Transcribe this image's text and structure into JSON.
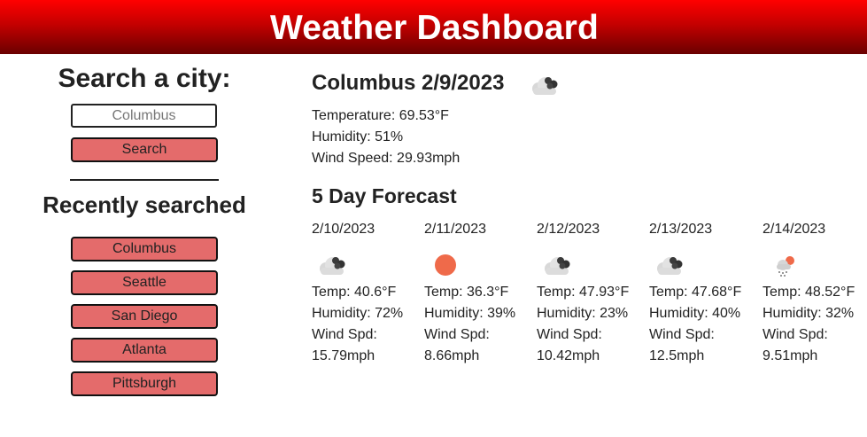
{
  "header": {
    "title": "Weather Dashboard"
  },
  "sidebar": {
    "search_title": "Search a city:",
    "search_placeholder": "Columbus",
    "search_button": "Search",
    "recent_title": "Recently searched",
    "recent": [
      "Columbus",
      "Seattle",
      "San Diego",
      "Atlanta",
      "Pittsburgh"
    ]
  },
  "current": {
    "title": "Columbus 2/9/2023",
    "icon": "cloudy-icon",
    "temperature": "Temperature: 69.53°F",
    "humidity": "Humidity: 51%",
    "wind": "Wind Speed: 29.93mph"
  },
  "forecast": {
    "title": "5 Day Forecast",
    "days": [
      {
        "date": "2/10/2023",
        "icon": "cloudy-icon",
        "temp": "Temp: 40.6°F",
        "humidity": "Humidity: 72%",
        "wind": "Wind Spd: 15.79mph"
      },
      {
        "date": "2/11/2023",
        "icon": "sun-icon",
        "temp": "Temp: 36.3°F",
        "humidity": "Humidity: 39%",
        "wind": "Wind Spd: 8.66mph"
      },
      {
        "date": "2/12/2023",
        "icon": "cloudy-icon",
        "temp": "Temp: 47.93°F",
        "humidity": "Humidity: 23%",
        "wind": "Wind Spd: 10.42mph"
      },
      {
        "date": "2/13/2023",
        "icon": "cloudy-icon",
        "temp": "Temp: 47.68°F",
        "humidity": "Humidity: 40%",
        "wind": "Wind Spd: 12.5mph"
      },
      {
        "date": "2/14/2023",
        "icon": "rain-sun-icon",
        "temp": "Temp: 48.52°F",
        "humidity": "Humidity: 32%",
        "wind": "Wind Spd: 9.51mph"
      }
    ]
  },
  "colors": {
    "header_top": "#ff0000",
    "header_bottom": "#6a0000",
    "button": "#e46b6b",
    "sun": "#ef6a4a"
  }
}
